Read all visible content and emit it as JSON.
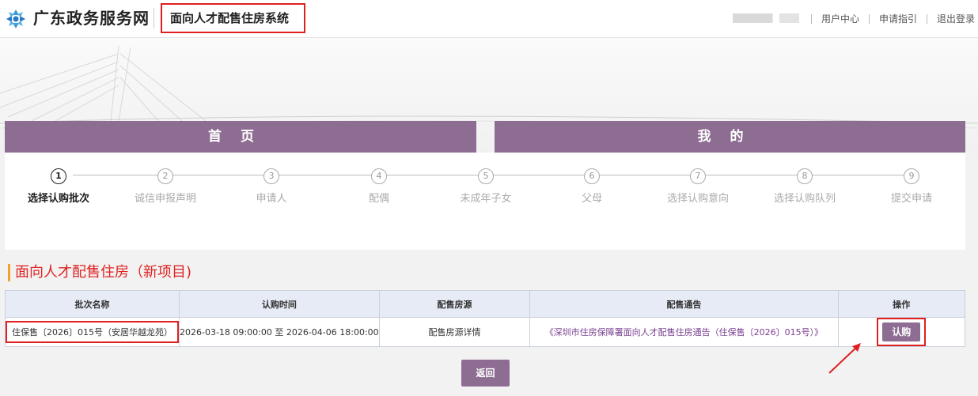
{
  "header": {
    "brand": "广东政务服务网",
    "system_title": "面向人才配售住房系统",
    "links": [
      "用户中心",
      "申请指引",
      "退出登录"
    ]
  },
  "tabs": {
    "left": "首页",
    "right": "我的"
  },
  "steps": [
    {
      "num": "1",
      "label": "选择认购批次",
      "active": true
    },
    {
      "num": "2",
      "label": "诚信申报声明",
      "active": false
    },
    {
      "num": "3",
      "label": "申请人",
      "active": false
    },
    {
      "num": "4",
      "label": "配偶",
      "active": false
    },
    {
      "num": "5",
      "label": "未成年子女",
      "active": false
    },
    {
      "num": "6",
      "label": "父母",
      "active": false
    },
    {
      "num": "7",
      "label": "选择认购意向",
      "active": false
    },
    {
      "num": "8",
      "label": "选择认购队列",
      "active": false
    },
    {
      "num": "9",
      "label": "提交申请",
      "active": false
    }
  ],
  "section": {
    "title": "面向人才配售住房（新项目)"
  },
  "table": {
    "headers": [
      "批次名称",
      "认购时间",
      "配售房源",
      "配售通告",
      "操作"
    ],
    "rows": [
      {
        "batch": "住保售〔2026〕015号（安居华越龙苑）",
        "time": "2026-03-18 09:00:00 至 2026-04-06 18:00:00",
        "source": "配售房源详情",
        "notice": "《深圳市住房保障署面向人才配售住房通告（住保售〔2026〕015号）》",
        "action": "认购"
      }
    ]
  },
  "back_label": "返回",
  "colors": {
    "accent": "#8e6d92",
    "highlight": "#e02020",
    "section_title": "#e02222"
  }
}
